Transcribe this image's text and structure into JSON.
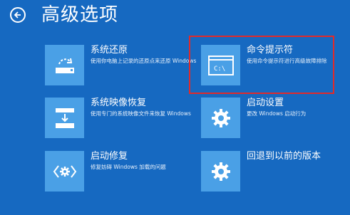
{
  "header": {
    "title": "高级选项",
    "back_icon": "back-arrow-icon"
  },
  "options": [
    {
      "name": "系统还原",
      "desc": "使用你电脑上记录的还原点来还原 Windows",
      "icon": "system-restore-icon"
    },
    {
      "name": "命令提示符",
      "desc": "使用命令提示符进行高级故障排除",
      "icon": "command-prompt-icon",
      "icon_text": "C:\\"
    },
    {
      "name": "系统映像恢复",
      "desc": "使用专门的系统映像文件来恢复 Windows",
      "icon": "system-image-icon"
    },
    {
      "name": "启动设置",
      "desc": "更改 Windows 启动行为",
      "icon": "gear-icon"
    },
    {
      "name": "启动修复",
      "desc": "修复妨碍 Windows 加载的问题",
      "icon": "startup-repair-icon"
    },
    {
      "name": "回退到以前的版本",
      "desc": "",
      "icon": "gear-icon"
    }
  ],
  "colors": {
    "background": "#1669c1",
    "tile": "#4aa0e6",
    "highlight": "#e22a2a"
  }
}
